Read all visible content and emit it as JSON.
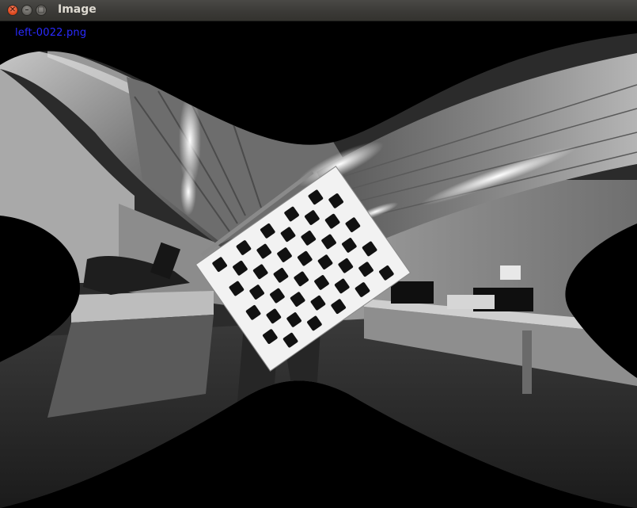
{
  "window": {
    "title": "Image",
    "close_glyph": "✕",
    "minimize_glyph": "–",
    "maximize_glyph": "▢"
  },
  "image": {
    "filename_label": "left-0022.png",
    "label_color": "#2a2aff"
  }
}
